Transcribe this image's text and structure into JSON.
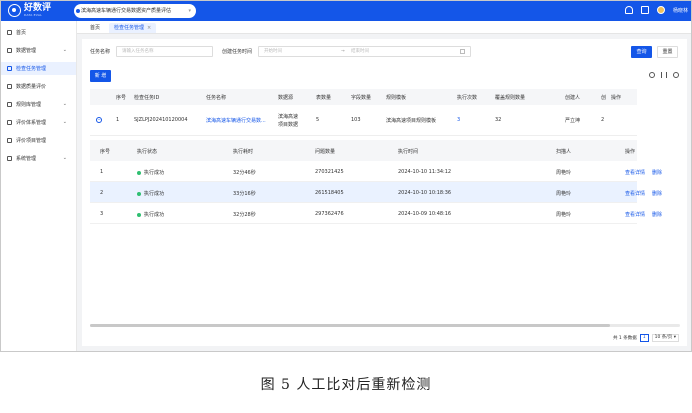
{
  "app": {
    "logo_title": "好数评",
    "logo_sub": "DATA EVAL"
  },
  "header": {
    "project": "滨海高速车辆通行交易数据资产质量评估",
    "username": "杨晓林"
  },
  "sidebar": {
    "items": [
      {
        "label": "首页",
        "expandable": false,
        "active": false
      },
      {
        "label": "数据管理",
        "expandable": true,
        "active": false
      },
      {
        "label": "检查任务管理",
        "expandable": false,
        "active": true
      },
      {
        "label": "数据质量评价",
        "expandable": false,
        "active": false
      },
      {
        "label": "规则库管理",
        "expandable": true,
        "active": false
      },
      {
        "label": "评价体系管理",
        "expandable": true,
        "active": false
      },
      {
        "label": "评价项目管理",
        "expandable": false,
        "active": false
      },
      {
        "label": "系统管理",
        "expandable": true,
        "active": false
      }
    ]
  },
  "tabs": [
    {
      "label": "首页"
    },
    {
      "label": "检查任务管理"
    }
  ],
  "filter": {
    "name_label": "任务名称",
    "name_placeholder": "请输入任务名称",
    "time_label": "创建任务时间",
    "start_placeholder": "开始时间",
    "arrow": "→",
    "end_placeholder": "结束时间",
    "query": "查询",
    "reset": "重置"
  },
  "toolbar": {
    "new": "新 增"
  },
  "table": {
    "headers": [
      "序号",
      "检查任务ID",
      "任务名称",
      "数据源",
      "表数量",
      "字段数量",
      "规则模板",
      "执行次数",
      "覆盖规则数量",
      "创建人",
      "创",
      "操作"
    ],
    "row": {
      "index": "1",
      "id": "SJZLPJ202410120004",
      "name": "滨海高速车辆通行交易数...",
      "source": "滨海高速项目数据",
      "tables": "5",
      "fields": "103",
      "template": "滨海高速项目规则模板",
      "runs": "3",
      "rules": "32",
      "creator": "严立坤",
      "created": "2"
    }
  },
  "sub_table": {
    "headers": [
      "序号",
      "执行状态",
      "执行耗时",
      "问题数量",
      "执行时间",
      "扫描人",
      "操作"
    ],
    "rows": [
      {
        "index": "1",
        "status": "执行成功",
        "duration": "32分46秒",
        "issues": "270321425",
        "time": "2024-10-10 11:34:12",
        "scanner": "周艳玲",
        "view": "查看详情",
        "delete": "删除"
      },
      {
        "index": "2",
        "status": "执行成功",
        "duration": "33分16秒",
        "issues": "261518405",
        "time": "2024-10-10 10:18:36",
        "scanner": "周艳玲",
        "view": "查看详情",
        "delete": "删除"
      },
      {
        "index": "3",
        "status": "执行成功",
        "duration": "32分28秒",
        "issues": "297362476",
        "time": "2024-10-09 10:48:16",
        "scanner": "周艳玲",
        "view": "查看详情",
        "delete": "删除"
      }
    ]
  },
  "pagination": {
    "total": "共 1 条数据",
    "page": "1",
    "page_size": "10 条/页"
  },
  "caption": "图 5  人工比对后重新检测"
}
